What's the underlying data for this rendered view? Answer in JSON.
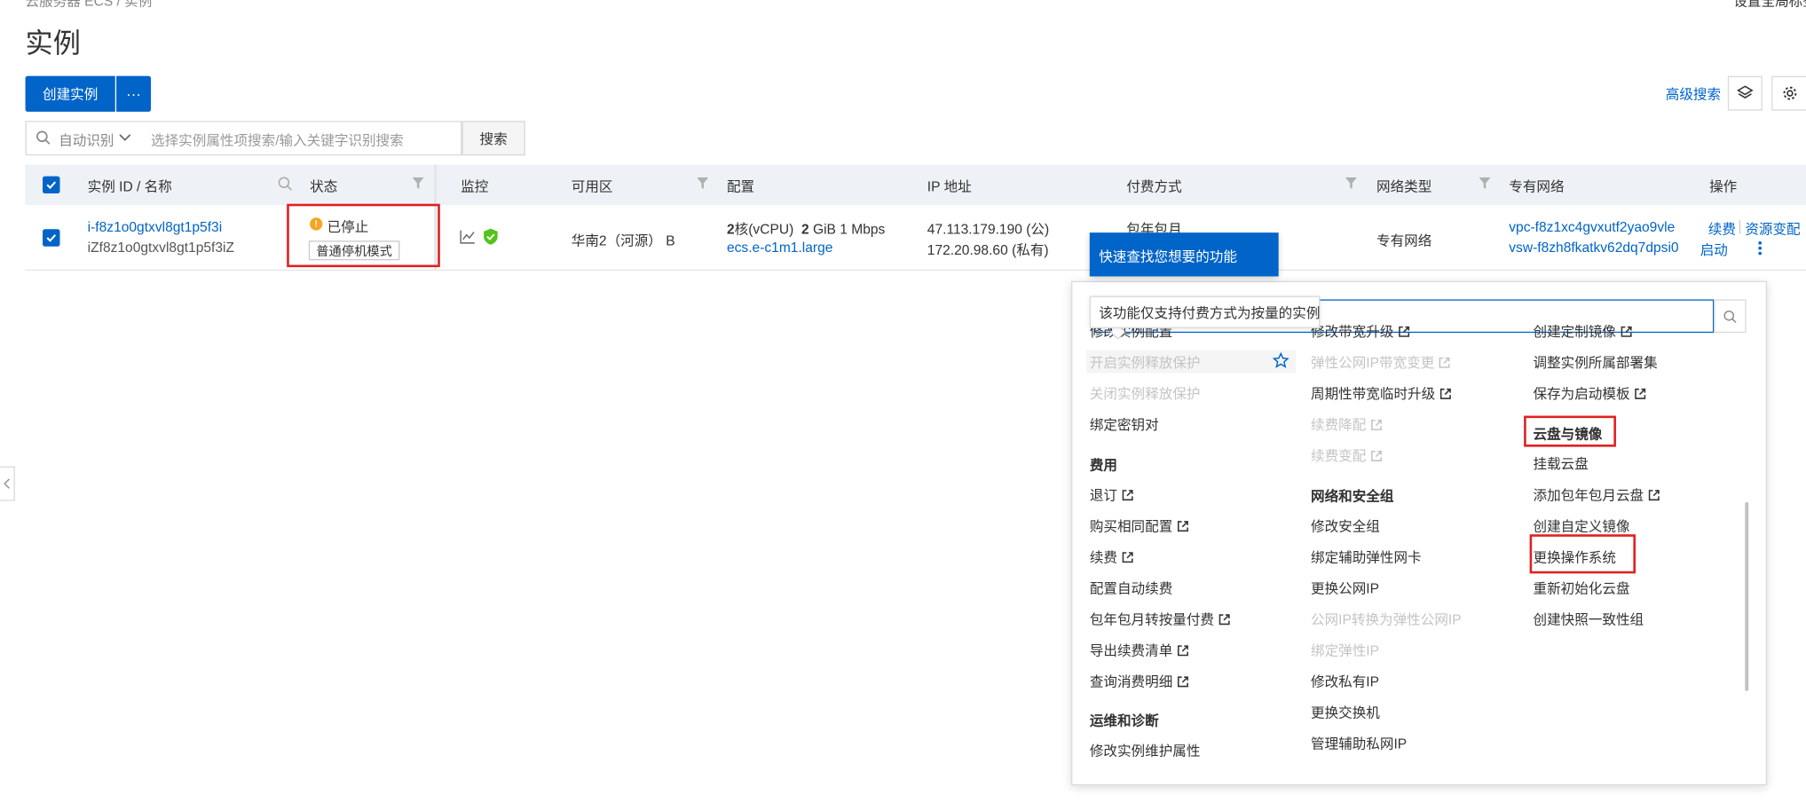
{
  "breadcrumb": "云服务器 ECS  /  实例",
  "top_right_link": "设置全局标签",
  "page_title": "实例",
  "toolbar": {
    "create_label": "创建实例",
    "more_label": "···",
    "advanced_search": "高级搜索"
  },
  "search": {
    "mode": "自动识别",
    "placeholder": "选择实例属性项搜索/输入关键字识别搜索",
    "button": "搜索"
  },
  "table": {
    "headers": {
      "id_name": "实例 ID / 名称",
      "status": "状态",
      "monitor": "监控",
      "zone": "可用区",
      "config": "配置",
      "ip": "IP 地址",
      "billing": "付费方式",
      "net_type": "网络类型",
      "vpc": "专有网络",
      "ops": "操作"
    },
    "row": {
      "id": "i-f8z1o0gtxvl8gt1p5f3i",
      "name": "iZf8z1o0gtxvl8gt1p5f3iZ",
      "status": "已停止",
      "status_mode": "普通停机模式",
      "zone": "华南2（河源） B",
      "cpu_num": "2",
      "cpu_unit": "核(vCPU)",
      "mem_num": "2",
      "mem_unit": "GiB 1 Mbps",
      "instance_type": "ecs.e-c1m1.large",
      "ip_public": "47.113.179.190 (公)",
      "ip_private": "172.20.98.60 (私有)",
      "billing": "包年包月",
      "net_type": "专有网络",
      "vpc": "vpc-f8z1xc4gvxutf2yao9vle",
      "vsw": "vsw-f8zh8fkatkv62dq7dpsi0",
      "op_renew": "续费",
      "op_change": "资源变配",
      "op_start": "启动"
    }
  },
  "guide": {
    "title": "快速查找您想要的功能"
  },
  "tooltip": "该功能仅支持付费方式为按量的实例",
  "popup": {
    "col1": [
      {
        "label": "修改实例配置"
      },
      {
        "label": "开启实例释放保护"
      },
      {
        "label": "关闭实例释放保护"
      },
      {
        "label": "绑定密钥对"
      },
      {
        "label": "费用"
      },
      {
        "label": "退订"
      },
      {
        "label": "购买相同配置"
      },
      {
        "label": "续费"
      },
      {
        "label": "配置自动续费"
      },
      {
        "label": "包年包月转按量付费"
      },
      {
        "label": "导出续费清单"
      },
      {
        "label": "查询消费明细"
      },
      {
        "label": "运维和诊断"
      },
      {
        "label": "修改实例维护属性"
      }
    ],
    "col2": [
      {
        "label": "修改带宽升级"
      },
      {
        "label": "弹性公网IP带宽变更"
      },
      {
        "label": "周期性带宽临时升级"
      },
      {
        "label": "续费降配"
      },
      {
        "label": "续费变配"
      },
      {
        "label": "网络和安全组"
      },
      {
        "label": "修改安全组"
      },
      {
        "label": "绑定辅助弹性网卡"
      },
      {
        "label": "更换公网IP"
      },
      {
        "label": "公网IP转换为弹性公网IP"
      },
      {
        "label": "绑定弹性IP"
      },
      {
        "label": "修改私有IP"
      },
      {
        "label": "更换交换机"
      },
      {
        "label": "管理辅助私网IP"
      }
    ],
    "col3": [
      {
        "label": "创建定制镜像"
      },
      {
        "label": "调整实例所属部署集"
      },
      {
        "label": "保存为启动模板"
      },
      {
        "label": "云盘与镜像"
      },
      {
        "label": "挂载云盘"
      },
      {
        "label": "添加包年包月云盘"
      },
      {
        "label": "创建自定义镜像"
      },
      {
        "label": "更换操作系统"
      },
      {
        "label": "重新初始化云盘"
      },
      {
        "label": "创建快照一致性组"
      }
    ]
  },
  "colors": {
    "primary": "#0064c8",
    "highlight_border": "#e02020",
    "warning": "#f5a623",
    "success": "#52c41a"
  }
}
